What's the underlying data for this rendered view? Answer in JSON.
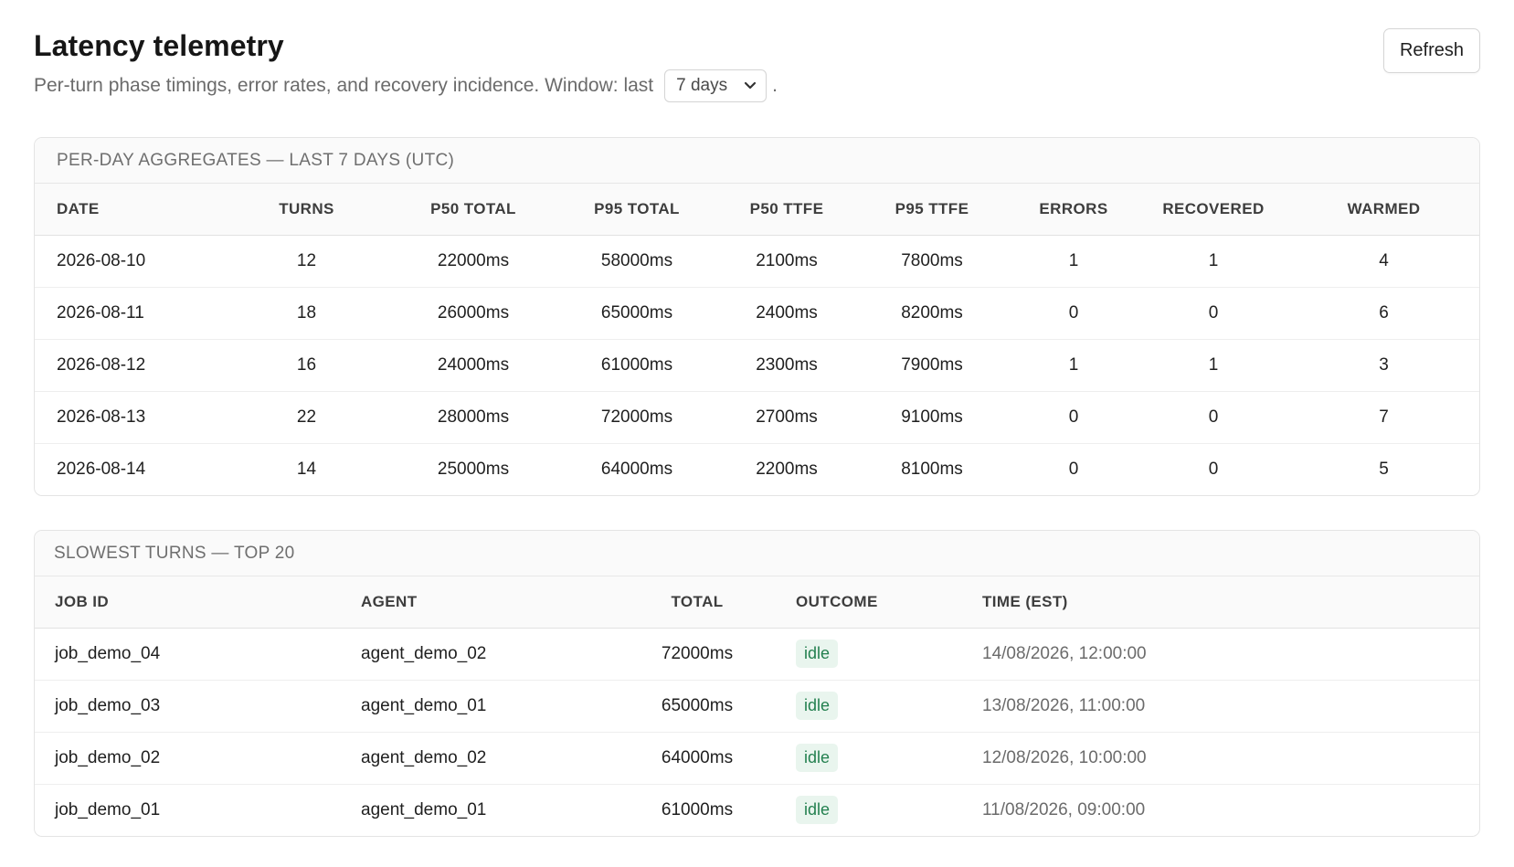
{
  "header": {
    "title": "Latency telemetry",
    "subtitle_prefix": "Per-turn phase timings, error rates, and recovery incidence. Window: last",
    "subtitle_suffix": ".",
    "window_selected": "7 days",
    "refresh_label": "Refresh"
  },
  "aggregates": {
    "title": "PER-DAY AGGREGATES — LAST 7 DAYS (UTC)",
    "columns": [
      "DATE",
      "TURNS",
      "P50 TOTAL",
      "P95 TOTAL",
      "P50 TTFE",
      "P95 TTFE",
      "ERRORS",
      "RECOVERED",
      "WARMED"
    ],
    "rows": [
      {
        "date": "2026-08-10",
        "turns": "12",
        "p50_total": "22000ms",
        "p95_total": "58000ms",
        "p50_ttfe": "2100ms",
        "p95_ttfe": "7800ms",
        "errors": "1",
        "recovered": "1",
        "warmed": "4"
      },
      {
        "date": "2026-08-11",
        "turns": "18",
        "p50_total": "26000ms",
        "p95_total": "65000ms",
        "p50_ttfe": "2400ms",
        "p95_ttfe": "8200ms",
        "errors": "0",
        "recovered": "0",
        "warmed": "6"
      },
      {
        "date": "2026-08-12",
        "turns": "16",
        "p50_total": "24000ms",
        "p95_total": "61000ms",
        "p50_ttfe": "2300ms",
        "p95_ttfe": "7900ms",
        "errors": "1",
        "recovered": "1",
        "warmed": "3"
      },
      {
        "date": "2026-08-13",
        "turns": "22",
        "p50_total": "28000ms",
        "p95_total": "72000ms",
        "p50_ttfe": "2700ms",
        "p95_ttfe": "9100ms",
        "errors": "0",
        "recovered": "0",
        "warmed": "7"
      },
      {
        "date": "2026-08-14",
        "turns": "14",
        "p50_total": "25000ms",
        "p95_total": "64000ms",
        "p50_ttfe": "2200ms",
        "p95_ttfe": "8100ms",
        "errors": "0",
        "recovered": "0",
        "warmed": "5"
      }
    ]
  },
  "slowest": {
    "title": "SLOWEST TURNS — TOP 20",
    "columns": [
      "JOB ID",
      "AGENT",
      "TOTAL",
      "OUTCOME",
      "TIME (EST)"
    ],
    "rows": [
      {
        "job_id": "job_demo_04",
        "agent": "agent_demo_02",
        "total": "72000ms",
        "outcome": "idle",
        "time": "14/08/2026, 12:00:00"
      },
      {
        "job_id": "job_demo_03",
        "agent": "agent_demo_01",
        "total": "65000ms",
        "outcome": "idle",
        "time": "13/08/2026, 11:00:00"
      },
      {
        "job_id": "job_demo_02",
        "agent": "agent_demo_02",
        "total": "64000ms",
        "outcome": "idle",
        "time": "12/08/2026, 10:00:00"
      },
      {
        "job_id": "job_demo_01",
        "agent": "agent_demo_01",
        "total": "61000ms",
        "outcome": "idle",
        "time": "11/08/2026, 09:00:00"
      }
    ]
  },
  "colors": {
    "badge_background": "#e9f5ee",
    "badge_text": "#23804f"
  }
}
